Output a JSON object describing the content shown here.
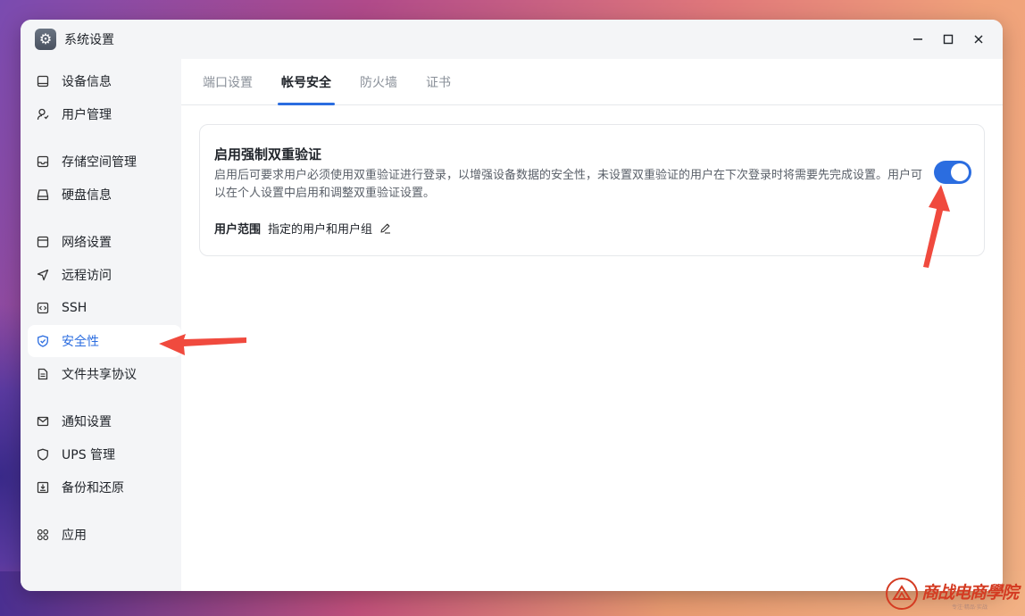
{
  "window": {
    "title": "系统设置",
    "app_icon": "gear-icon"
  },
  "sidebar": {
    "items": [
      {
        "label": "设备信息",
        "icon": "device-icon"
      },
      {
        "label": "用户管理",
        "icon": "user-icon"
      },
      {
        "label": "存储空间管理",
        "icon": "storage-icon"
      },
      {
        "label": "硬盘信息",
        "icon": "disk-icon"
      },
      {
        "label": "网络设置",
        "icon": "network-icon"
      },
      {
        "label": "远程访问",
        "icon": "send-icon"
      },
      {
        "label": "SSH",
        "icon": "code-icon"
      },
      {
        "label": "安全性",
        "icon": "shield-check-icon",
        "active": true
      },
      {
        "label": "文件共享协议",
        "icon": "file-icon"
      },
      {
        "label": "通知设置",
        "icon": "mail-icon"
      },
      {
        "label": "UPS 管理",
        "icon": "shield-icon"
      },
      {
        "label": "备份和还原",
        "icon": "backup-icon"
      },
      {
        "label": "应用",
        "icon": "apps-icon"
      }
    ]
  },
  "tabs": [
    {
      "label": "端口设置"
    },
    {
      "label": "帐号安全",
      "active": true
    },
    {
      "label": "防火墙"
    },
    {
      "label": "证书"
    }
  ],
  "card": {
    "title": "启用强制双重验证",
    "description": "启用后可要求用户必须使用双重验证进行登录，以增强设备数据的安全性，未设置双重验证的用户在下次登录时将需要先完成设置。用户可以在个人设置中启用和调整双重验证设置。",
    "toggle_on": true,
    "scope_label": "用户范围",
    "scope_value": "指定的用户和用户组"
  },
  "watermark": {
    "main": "商战电商學院",
    "sub": "专注·精品·实战"
  },
  "colors": {
    "accent": "#2b6de0",
    "arrow": "#f04a3e",
    "watermark": "#d43b22"
  }
}
